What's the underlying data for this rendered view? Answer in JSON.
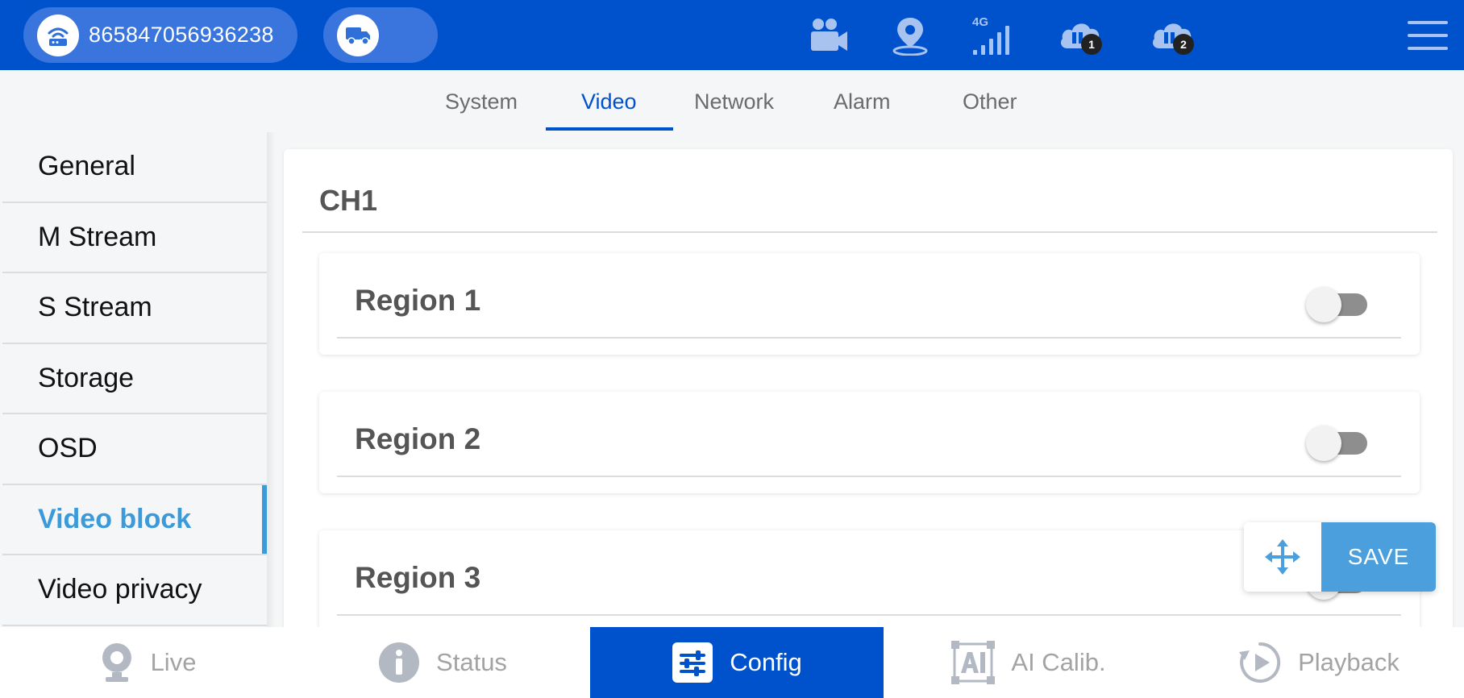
{
  "header": {
    "device_id": "865847056936238",
    "icons": [
      "router-icon",
      "truck-icon",
      "camera-icon",
      "location-icon",
      "signal-4g-icon",
      "cloud-server-1-icon",
      "cloud-server-2-icon",
      "menu-icon"
    ],
    "network_type": "4G",
    "cloud_badge_1": "1",
    "cloud_badge_2": "2"
  },
  "tabs": [
    {
      "label": "System"
    },
    {
      "label": "Video",
      "active": true
    },
    {
      "label": "Network"
    },
    {
      "label": "Alarm"
    },
    {
      "label": "Other"
    }
  ],
  "sidebar": {
    "items": [
      {
        "label": "General"
      },
      {
        "label": "M Stream"
      },
      {
        "label": "S Stream"
      },
      {
        "label": "Storage"
      },
      {
        "label": "OSD"
      },
      {
        "label": "Video block",
        "active": true
      },
      {
        "label": "Video privacy"
      }
    ]
  },
  "main": {
    "channel_title": "CH1",
    "regions": [
      {
        "label": "Region 1",
        "enabled": false
      },
      {
        "label": "Region 2",
        "enabled": false
      },
      {
        "label": "Region 3",
        "enabled": false
      }
    ]
  },
  "actions": {
    "save_label": "SAVE"
  },
  "bottom_nav": [
    {
      "label": "Live"
    },
    {
      "label": "Status"
    },
    {
      "label": "Config",
      "active": true
    },
    {
      "label": "AI Calib."
    },
    {
      "label": "Playback"
    }
  ],
  "colors": {
    "brand_blue": "#0052cc",
    "accent_blue": "#4a9fdc",
    "sidebar_active": "#3b9ad9"
  }
}
